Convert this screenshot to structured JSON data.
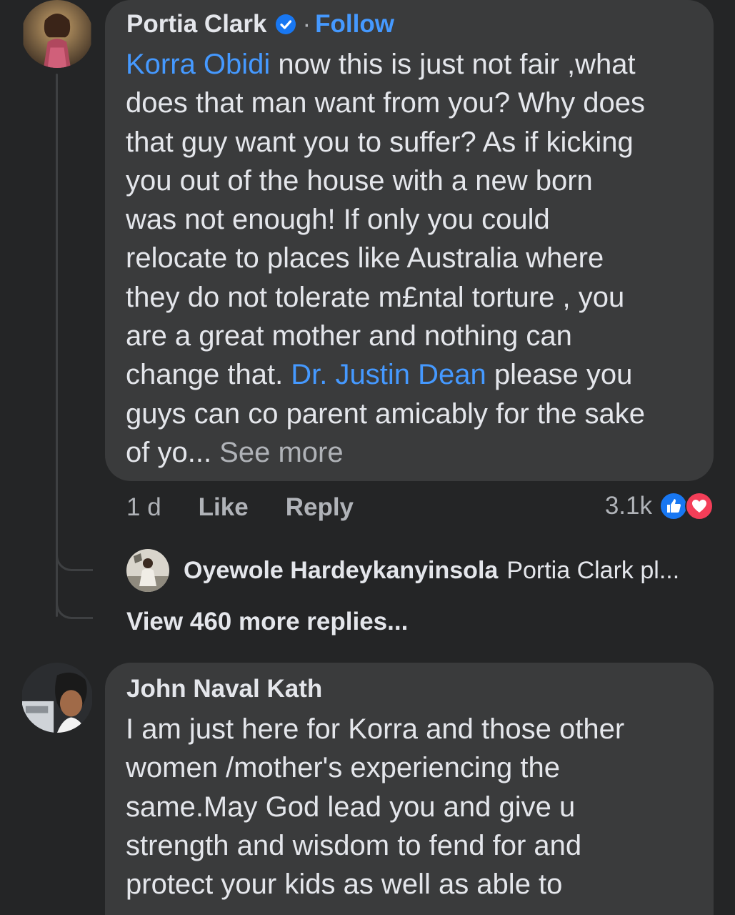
{
  "comment1": {
    "author": "Portia Clark",
    "separator": "·",
    "follow_label": "Follow",
    "lines": [
      [
        {
          "t": "Korra Obidi",
          "m": true
        },
        {
          "t": " now this is just not fair ,what"
        }
      ],
      [
        {
          "t": "does that man want from you? Why does"
        }
      ],
      [
        {
          "t": "that guy  want you to suffer? As if kicking"
        }
      ],
      [
        {
          "t": "you out of the house with a new born"
        }
      ],
      [
        {
          "t": "was not enough! If only you could"
        }
      ],
      [
        {
          "t": "relocate to places like Australia where"
        }
      ],
      [
        {
          "t": "they do not tolerate m£ntal torture , you"
        }
      ],
      [
        {
          "t": "are a great mother and nothing can"
        }
      ],
      [
        {
          "t": "change that. "
        },
        {
          "t": "Dr. Justin Dean",
          "m": true
        },
        {
          "t": " please you"
        }
      ],
      [
        {
          "t": "guys can co parent amicably for the sake"
        }
      ],
      [
        {
          "t": "of yo... "
        },
        {
          "t": "See more",
          "s": true
        }
      ]
    ],
    "time": "1 d",
    "like_label": "Like",
    "reply_label": "Reply",
    "reaction_count": "3.1k"
  },
  "reply_preview": {
    "author": "Oyewole Hardeykanyinsola",
    "snippet": "Portia Clark pl..."
  },
  "view_more_label": "View 460 more replies...",
  "comment2": {
    "author": "John Naval Kath",
    "lines": [
      "I am just here for Korra and those other",
      "women /mother's experiencing the",
      "same.May God lead you and give u",
      "strength and wisdom to fend for and",
      "protect  your kids as well as able to"
    ]
  },
  "colors": {
    "background": "#242526",
    "bubble": "#3a3b3c",
    "mention": "#4599ff",
    "secondary_text": "#b0b3b8",
    "like_blue": "#1877f2",
    "love_red": "#f33e58"
  }
}
